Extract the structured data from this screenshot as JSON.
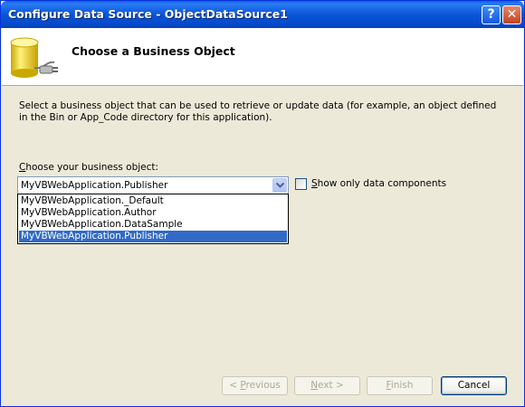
{
  "window": {
    "title": "Configure Data Source - ObjectDataSource1"
  },
  "title_buttons": {
    "help": "?",
    "close": "✕"
  },
  "header": {
    "title": "Choose a Business Object",
    "icon": "database-plug-icon"
  },
  "description": "Select a business object that can be used to retrieve or update data (for example, an object defined in the Bin or App_Code directory for this application).",
  "business_object": {
    "label_prefix": "",
    "label_accesskey": "C",
    "label_rest": "hoose your business object:",
    "selected_value": "MyVBWebApplication.Publisher",
    "options": [
      "MyVBWebApplication._Default",
      "MyVBWebApplication.Author",
      "MyVBWebApplication.DataSample",
      "MyVBWebApplication.Publisher"
    ],
    "selected_index": 3
  },
  "show_only_data_components": {
    "label_accesskey": "S",
    "label_rest": "how only data components",
    "checked": false
  },
  "buttons": {
    "previous_accesskey": "P",
    "previous_prefix": "< ",
    "previous_rest": "revious",
    "next_accesskey": "N",
    "next_rest": "ext >",
    "finish_accesskey": "F",
    "finish_rest": "inish",
    "cancel": "Cancel"
  },
  "colors": {
    "title_bar": "#0a55d9",
    "selection": "#316ac5",
    "dialog_bg": "#ece9d8"
  }
}
